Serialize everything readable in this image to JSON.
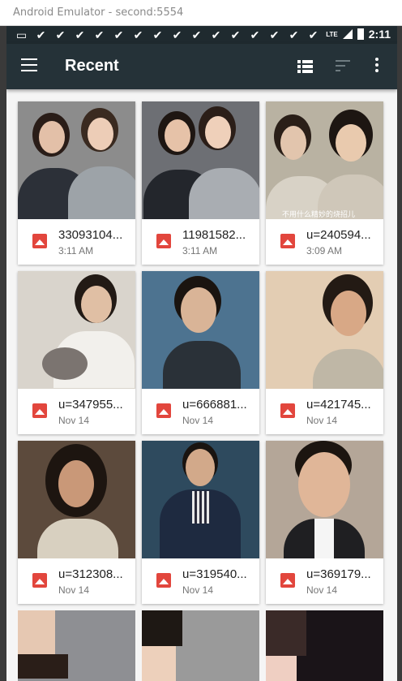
{
  "window": {
    "title": "Android Emulator - second:5554"
  },
  "status_bar": {
    "notification_icons": [
      "message-icon",
      "check-icon",
      "check-icon",
      "check-icon",
      "check-icon",
      "check-icon",
      "check-icon",
      "check-icon",
      "check-icon",
      "check-icon",
      "check-icon",
      "check-icon",
      "check-icon",
      "check-icon",
      "check-icon",
      "check-icon"
    ],
    "network": "LTE",
    "time": "2:11"
  },
  "toolbar": {
    "title": "Recent",
    "menu_icon": "hamburger-menu-icon",
    "view_icon": "list-view-icon",
    "sort_icon": "sort-icon",
    "more_icon": "more-vert-icon"
  },
  "files": [
    {
      "name": "33093104...",
      "date": "3:11 AM"
    },
    {
      "name": "11981582...",
      "date": "3:11 AM"
    },
    {
      "name": "u=240594...",
      "date": "3:09 AM"
    },
    {
      "name": "u=347955...",
      "date": "Nov 14"
    },
    {
      "name": "u=666881...",
      "date": "Nov 14"
    },
    {
      "name": "u=421745...",
      "date": "Nov 14"
    },
    {
      "name": "u=312308...",
      "date": "Nov 14"
    },
    {
      "name": "u=319540...",
      "date": "Nov 14"
    },
    {
      "name": "u=369179...",
      "date": "Nov 14"
    }
  ],
  "thumbnail_caption": "不用什么精妙的烧招儿",
  "colors": {
    "toolbar": "#253238",
    "status_bar": "#1f2a2f",
    "image_icon": "#e2463d",
    "background": "#f5f5f5"
  }
}
